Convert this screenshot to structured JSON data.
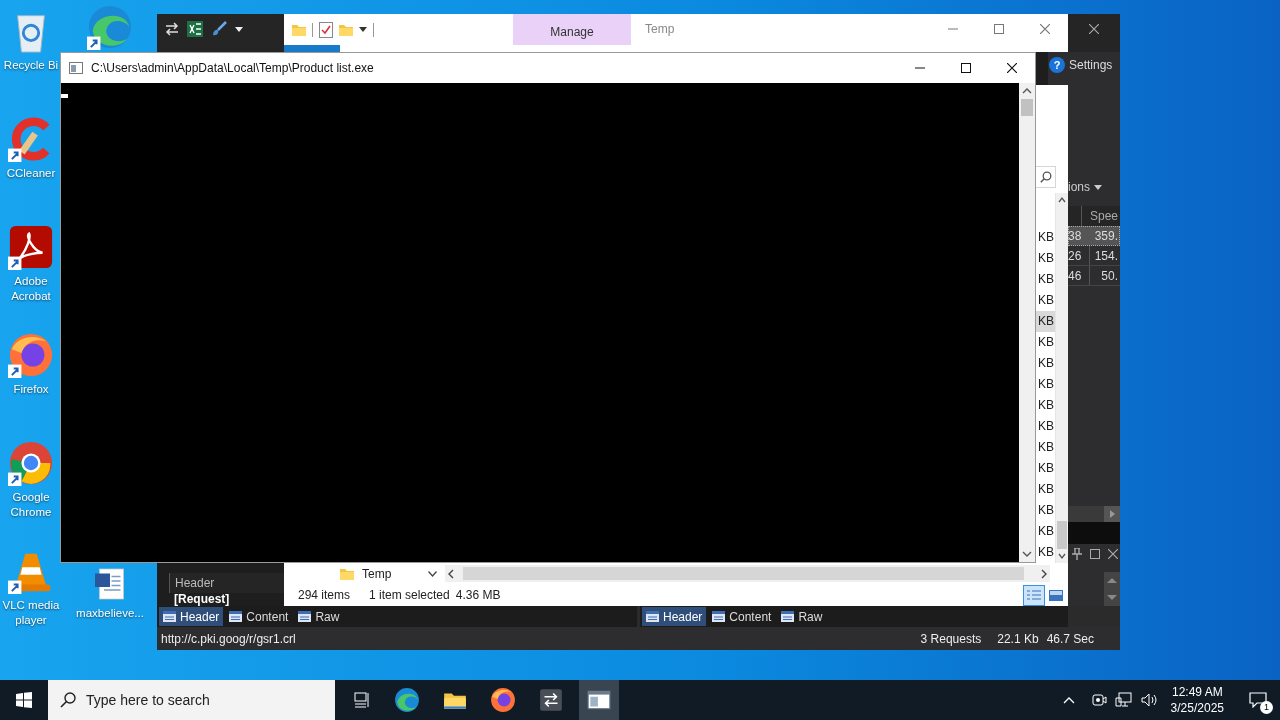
{
  "desktop": {
    "column_1": [
      {
        "kind": "recycle-bin",
        "label": "Recycle Bi"
      },
      {
        "kind": "ccleaner",
        "label": "CCleaner"
      },
      {
        "kind": "acrobat",
        "label": "Adobe Acrobat"
      },
      {
        "kind": "firefox",
        "label": "Firefox"
      },
      {
        "kind": "chrome",
        "label": "Google Chrome"
      },
      {
        "kind": "vlc",
        "label": "VLC media player"
      }
    ],
    "column_2": [
      {
        "kind": "edge"
      },
      {
        "kind": "word",
        "label": "maxbelieve..."
      }
    ]
  },
  "fiddler": {
    "help_glyph": "?",
    "settings_label": "Settings",
    "actions_label": "ions",
    "column_2_header": "Spee",
    "rows": [
      {
        "column_1": "38",
        "column_2": "359.",
        "selected": true
      },
      {
        "column_1": "26",
        "column_2": "154.",
        "selected": false
      },
      {
        "column_1": "46",
        "column_2": "50.",
        "selected": false
      }
    ],
    "inspector_header": "Header",
    "request_label": "[Request]",
    "inspector_tabs": [
      {
        "tabs": [
          {
            "label": "Header",
            "selected": true
          },
          {
            "label": "Content",
            "selected": false
          },
          {
            "label": "Raw",
            "selected": false
          }
        ]
      },
      {
        "tabs": [
          {
            "label": "Header",
            "selected": true
          },
          {
            "label": "Content",
            "selected": false
          },
          {
            "label": "Raw",
            "selected": false
          }
        ]
      }
    ],
    "status_bar": {
      "url": "http://c.pki.goog/r/gsr1.crl",
      "requests": "3 Requests",
      "size": "22.1 Kb",
      "elapsed": "46.7 Sec"
    }
  },
  "explorer": {
    "ribbon_tab": "Manage",
    "title": "Temp",
    "size_cells": [
      {
        "text": "KB",
        "selected": false
      },
      {
        "text": "KB",
        "selected": false
      },
      {
        "text": "KB",
        "selected": false
      },
      {
        "text": "KB",
        "selected": false
      },
      {
        "text": "KB",
        "selected": true
      },
      {
        "text": "KB",
        "selected": false
      },
      {
        "text": "KB",
        "selected": false
      },
      {
        "text": "KB",
        "selected": false
      },
      {
        "text": "KB",
        "selected": false
      },
      {
        "text": "KB",
        "selected": false
      },
      {
        "text": "KB",
        "selected": false
      },
      {
        "text": "KB",
        "selected": false
      },
      {
        "text": "KB",
        "selected": false
      },
      {
        "text": "KB",
        "selected": false
      },
      {
        "text": "KB",
        "selected": false
      },
      {
        "text": "KB",
        "selected": false
      }
    ],
    "address_folder": "Temp",
    "status_bar": {
      "item_count": "294 items",
      "selection": "1 item selected",
      "selection_size": "4.36 MB"
    },
    "views": [
      {
        "kind": "details",
        "selected": true
      },
      {
        "kind": "large-icons",
        "selected": false
      }
    ]
  },
  "console": {
    "title": "C:\\Users\\admin\\AppData\\Local\\Temp\\Product list.exe"
  },
  "taskbar": {
    "search_placeholder": "Type here to search",
    "apps": [
      {
        "kind": "edge",
        "active": false
      },
      {
        "kind": "explorer",
        "active": false
      },
      {
        "kind": "firefox",
        "active": false
      },
      {
        "kind": "fiddler",
        "active": false
      },
      {
        "kind": "console",
        "active": true
      }
    ],
    "time": "12:49 AM",
    "date": "3/25/2025",
    "notification_count": "1"
  }
}
